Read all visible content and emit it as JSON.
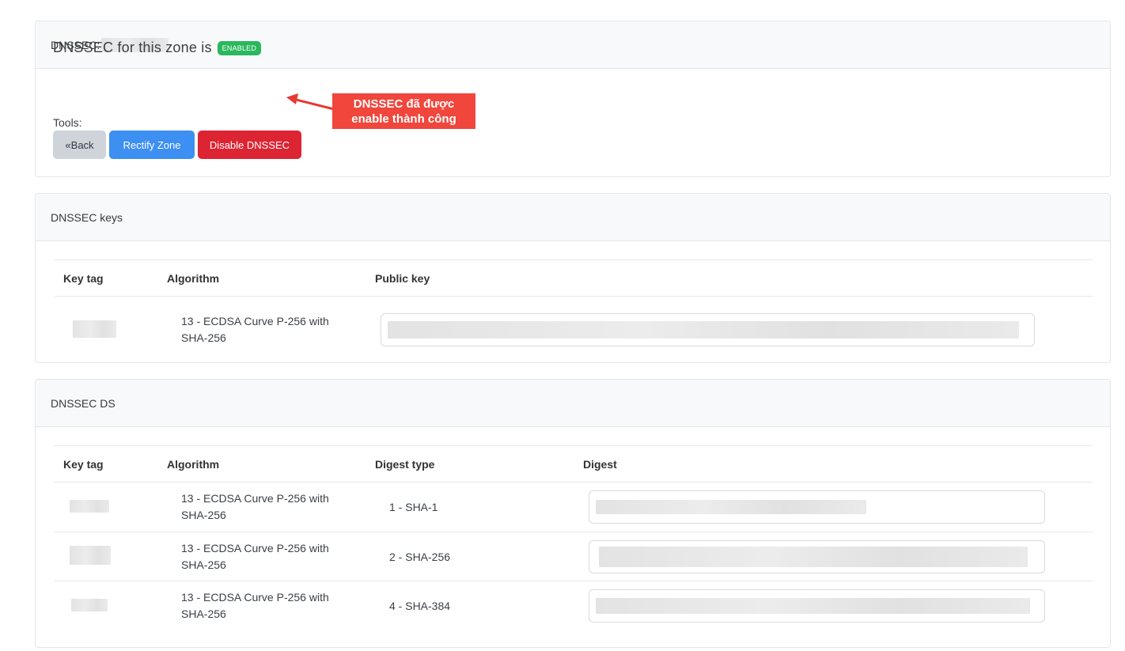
{
  "status_card": {
    "header_label": "DNSSEC:",
    "status_text": "DNSSEC for this zone is",
    "status_badge": "ENABLED",
    "tools_label": "Tools:",
    "buttons": {
      "back": "«Back",
      "rectify": "Rectify Zone",
      "disable": "Disable DNSSEC"
    },
    "callout": {
      "line1": "DNSSEC đã được",
      "line2": "enable thành công"
    }
  },
  "keys_card": {
    "header": "DNSSEC keys",
    "columns": [
      "Key tag",
      "Algorithm",
      "Public key"
    ],
    "rows": [
      {
        "algorithm_line1": "13 - ECDSA Curve P-256 with",
        "algorithm_line2": "SHA-256"
      }
    ]
  },
  "ds_card": {
    "header": "DNSSEC DS",
    "columns": [
      "Key tag",
      "Algorithm",
      "Digest type",
      "Digest"
    ],
    "rows": [
      {
        "algorithm_line1": "13 - ECDSA Curve P-256 with",
        "algorithm_line2": "SHA-256",
        "digest_type": "1 - SHA-1"
      },
      {
        "algorithm_line1": "13 - ECDSA Curve P-256 with",
        "algorithm_line2": "SHA-256",
        "digest_type": "2 - SHA-256"
      },
      {
        "algorithm_line1": "13 - ECDSA Curve P-256 with",
        "algorithm_line2": "SHA-256",
        "digest_type": "4 - SHA-384"
      }
    ]
  },
  "colors": {
    "badge_enabled": "#2ab75e",
    "button_back": "#ced4da",
    "button_rectify": "#3d8ff2",
    "button_disable": "#dd2433",
    "callout": "#f0463c"
  }
}
